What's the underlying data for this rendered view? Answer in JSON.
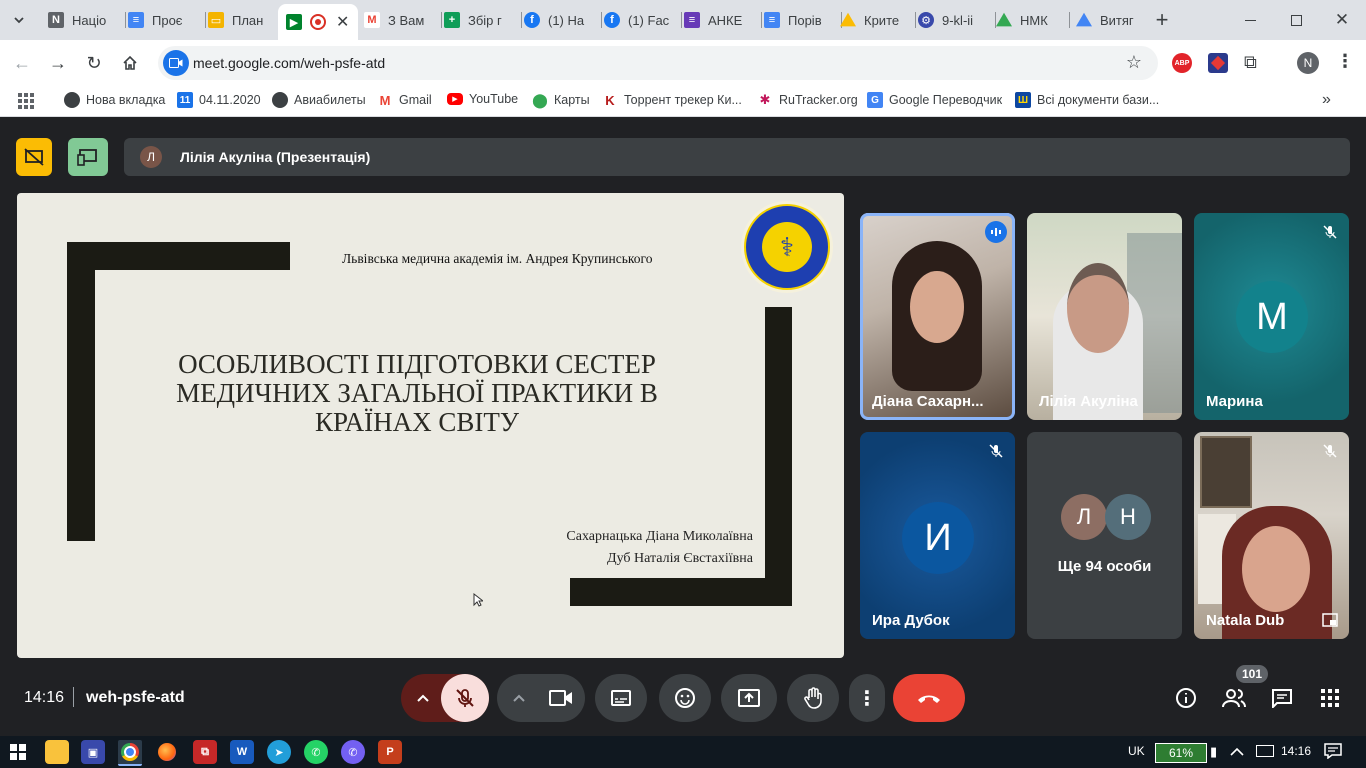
{
  "browser": {
    "tabs": [
      {
        "label": "Націо",
        "icon": "doc-icon"
      },
      {
        "label": "Проє",
        "icon": "docs-icon"
      },
      {
        "label": "План",
        "icon": "slides-icon"
      },
      {
        "label": "",
        "icon": "meet-icon"
      },
      {
        "label": "З Вам",
        "icon": "gmail-icon"
      },
      {
        "label": "Збір г",
        "icon": "sheets-icon"
      },
      {
        "label": "(1) На",
        "icon": "facebook-icon"
      },
      {
        "label": "(1) Fac",
        "icon": "facebook-icon"
      },
      {
        "label": "АНКЕ",
        "icon": "forms-icon"
      },
      {
        "label": "Порів",
        "icon": "docs-icon"
      },
      {
        "label": "Крите",
        "icon": "drive-icon"
      },
      {
        "label": "9-kl-ii",
        "icon": "site-icon"
      },
      {
        "label": "НМК",
        "icon": "drive-icon"
      },
      {
        "label": "Витяг",
        "icon": "drive-icon"
      }
    ],
    "url": "meet.google.com/weh-psfe-atd",
    "profile_initial": "N",
    "bookmarks": [
      {
        "label": "Нова вкладка"
      },
      {
        "label": "04.11.2020"
      },
      {
        "label": "Авиабилеты"
      },
      {
        "label": "Gmail"
      },
      {
        "label": "YouTube"
      },
      {
        "label": "Карты"
      },
      {
        "label": "Торрент трекер Ки..."
      },
      {
        "label": "RuTracker.org"
      },
      {
        "label": "Google Переводчик"
      },
      {
        "label": "Всі документи бази..."
      }
    ]
  },
  "meet": {
    "presenter_initial": "Л",
    "presenter_label": "Лілія Акуліна (Презентація)",
    "slide": {
      "institution": "Львівська медична академія ім. Андрея Крупинського",
      "title_lines": [
        "ОСОБЛИВОСТІ ПІДГОТОВКИ СЕСТЕР",
        "МЕДИЧНИХ ЗАГАЛЬНОЇ ПРАКТИКИ В",
        "КРАЇНАХ СВІТУ"
      ],
      "authors": [
        "Сахарнацька Діана Миколаївна",
        "Дуб Наталія Євстахіївна"
      ]
    },
    "participants": [
      {
        "name": "Діана Сахарн...",
        "state": "speaking"
      },
      {
        "name": "Лілія Акуліна"
      },
      {
        "name": "Марина",
        "initial": "М",
        "color": "#12828c",
        "muted": true
      },
      {
        "name": "Ира Дубок",
        "initial": "И",
        "color": "#0b57a0",
        "muted": true
      },
      {
        "name": "Ще 94 особи",
        "initials": [
          "Л",
          "Н"
        ]
      },
      {
        "name": "Natala Dub",
        "muted": true
      }
    ],
    "time": "14:16",
    "meeting_code": "weh-psfe-atd",
    "people_count": "101"
  },
  "taskbar": {
    "lang": "UK",
    "battery": "61%",
    "clock": "14:16"
  },
  "colors": {
    "end_call": "#ea4335",
    "mic_off": "#f9dedc",
    "present": "#fbbc04",
    "companion": "#81c995"
  }
}
